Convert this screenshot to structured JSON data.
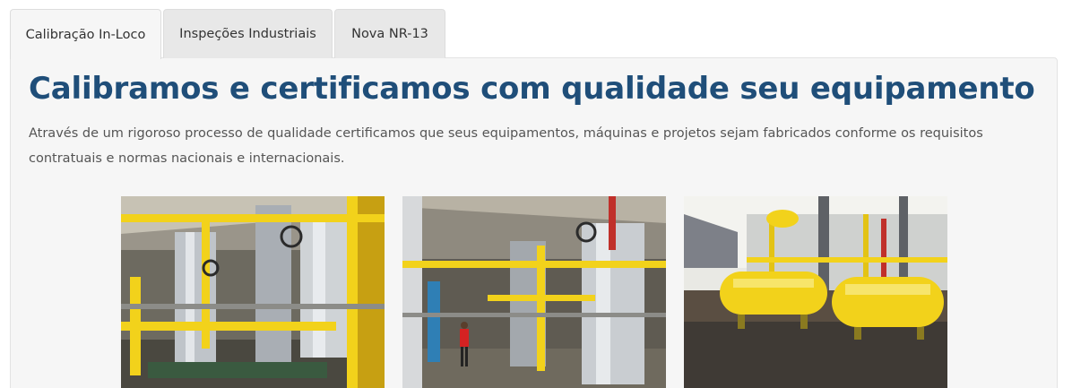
{
  "tabs": [
    {
      "label": "Calibração In-Loco",
      "active": true
    },
    {
      "label": "Inspeções Industriais",
      "active": false
    },
    {
      "label": "Nova NR-13",
      "active": false
    }
  ],
  "content": {
    "headline": "Calibramos e certificamos com qualidade seu equipamento",
    "description": "Através de um rigoroso processo de qualidade certificamos que seus equipamentos, máquinas e projetos sejam fabricados conforme os requisitos contratuais e normas nacionais e internacionais."
  },
  "colors": {
    "headline": "#1f4e79",
    "panel_bg": "#f6f6f6",
    "pipe_yellow": "#f2d21b",
    "pipe_steel": "#b9bec4"
  }
}
